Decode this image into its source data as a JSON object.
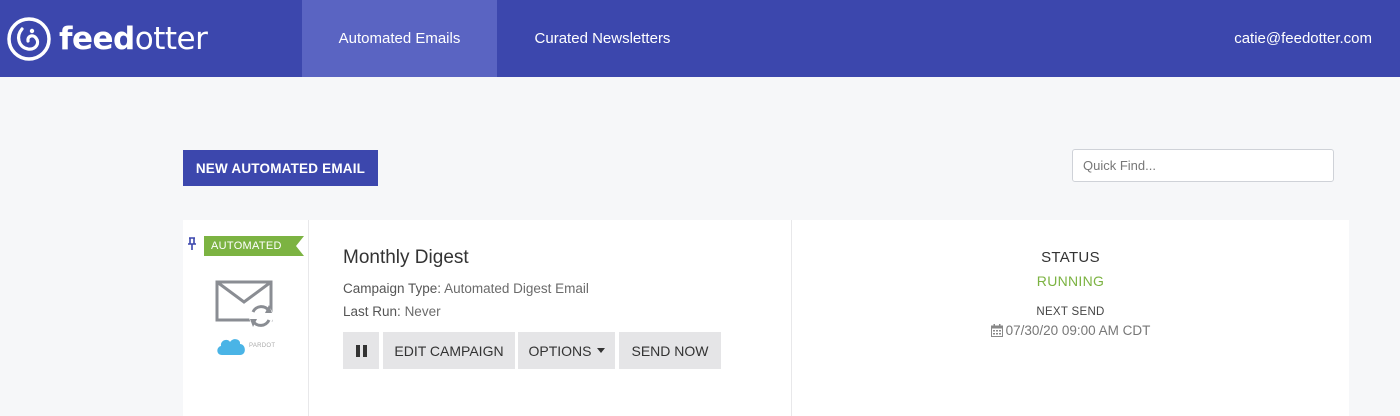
{
  "header": {
    "brand_bold": "feed",
    "brand_regular": "otter",
    "tabs": [
      {
        "label": "Automated Emails",
        "active": true
      },
      {
        "label": "Curated Newsletters",
        "active": false
      }
    ],
    "user_email": "catie@feedotter.com",
    "colors": {
      "nav_bg": "#3c47ad",
      "active_tab_bg": "#5a64c2"
    }
  },
  "toolbar": {
    "new_button_label": "NEW AUTOMATED EMAIL",
    "search_placeholder": "Quick Find..."
  },
  "campaign": {
    "badge": "AUTOMATED",
    "badge_color": "#7cb342",
    "integration_icon": "salesforce-pardot-logo",
    "integration_text": "PARDOT",
    "title": "Monthly Digest",
    "type_label": "Campaign Type:",
    "type_value": "Automated Digest Email",
    "last_run_label": "Last Run:",
    "last_run_value": "Never",
    "actions": {
      "edit": "EDIT CAMPAIGN",
      "options": "OPTIONS",
      "send": "SEND NOW"
    },
    "status_label": "STATUS",
    "status_value": "RUNNING",
    "status_color": "#7cb342",
    "next_send_label": "NEXT SEND",
    "next_send_value": "07/30/20 09:00 AM CDT"
  }
}
